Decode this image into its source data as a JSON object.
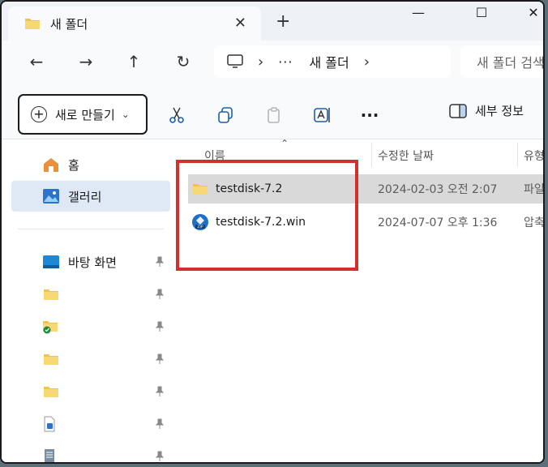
{
  "tab": {
    "title": "새 폴더",
    "close_glyph": "✕",
    "new_tab_glyph": "+"
  },
  "window_controls": {
    "minimize": "—",
    "maximize": "☐",
    "close": "✕"
  },
  "nav": {
    "back": "←",
    "forward": "→",
    "up": "↑",
    "refresh": "↻"
  },
  "address": {
    "more": "···",
    "separator": "›",
    "crumb": "새 폴더"
  },
  "search": {
    "placeholder": "새 폴더 검색"
  },
  "toolbar": {
    "new_label": "새로 만들기",
    "new_chevron": "⌄",
    "details_label": "세부 정보"
  },
  "sidebar": {
    "items": [
      {
        "label": "홈",
        "icon": "home-icon"
      },
      {
        "label": "갤러리",
        "icon": "gallery-icon"
      },
      {
        "label": "바탕 화면",
        "icon": "desktop-icon",
        "pinned": true
      },
      {
        "label": "",
        "icon": "folder-icon",
        "pinned": true
      },
      {
        "label": "",
        "icon": "folder-synced-icon",
        "pinned": true
      },
      {
        "label": "",
        "icon": "folder-icon",
        "pinned": true
      },
      {
        "label": "",
        "icon": "folder-icon",
        "pinned": true
      },
      {
        "label": "",
        "icon": "document-icon",
        "pinned": true
      },
      {
        "label": "",
        "icon": "text-file-icon",
        "pinned": true
      }
    ]
  },
  "columns": {
    "name": "이름",
    "modified": "수정한 날짜",
    "type": "유형"
  },
  "files": [
    {
      "name": "testdisk-7.2",
      "modified": "2024-02-03 오전 2:07",
      "type": "파일",
      "icon": "folder-icon",
      "selected": true
    },
    {
      "name": "testdisk-7.2.win",
      "modified": "2024-07-07 오후 1:36",
      "type": "압축",
      "icon": "zip-icon",
      "selected": false
    }
  ],
  "colors": {
    "highlight": "#d32f2f",
    "selection": "#d9d9d9",
    "sidebar_active": "#dfe9f5",
    "folder": "#f4c44a"
  }
}
